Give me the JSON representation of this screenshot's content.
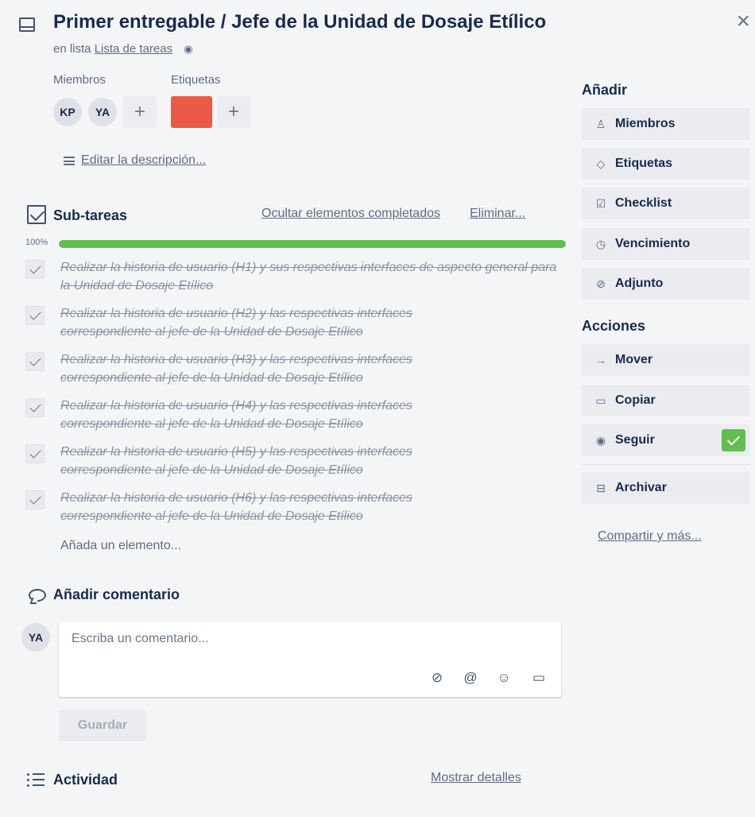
{
  "card": {
    "title": "Primer entregable / Jefe de la Unidad de Dosaje Etílico",
    "in_list_prefix": "en lista",
    "list_name": "Lista de tareas",
    "close_glyph": "×",
    "eye_glyph": "👁"
  },
  "members": {
    "label": "Miembros",
    "avatars": [
      "KP",
      "YA"
    ],
    "add_glyph": "+"
  },
  "labels": {
    "label": "Etiquetas",
    "color": "#eb5a46",
    "add_glyph": "+"
  },
  "description": {
    "link": "Editar la descripción..."
  },
  "checklist": {
    "title": "Sub-tareas",
    "hide_completed": "Ocultar elementos completados",
    "delete": "Eliminar...",
    "percent_label": "100%",
    "progress": 1.0,
    "progress_color": "#61bd4f",
    "items": [
      {
        "text": "Realizar la historia de usuario (H1) y sus respectivas interfaces de aspecto general para la Unidad de Dosaje Etílico",
        "checked": true
      },
      {
        "text": "Realizar la historia de usuario (H2) y las respectivas interfaces correspondiente al jefe de la Unidad de Dosaje Etílico",
        "checked": true
      },
      {
        "text": "Realizar la historia de usuario (H3) y las respectivas interfaces correspondiente al jefe de la Unidad de Dosaje Etílico",
        "checked": true
      },
      {
        "text": "Realizar la historia de usuario (H4) y las respectivas interfaces correspondiente al jefe de la Unidad de Dosaje Etílico",
        "checked": true
      },
      {
        "text": "Realizar la historia de usuario (H5) y las respectivas interfaces correspondiente al jefe de la Unidad de Dosaje Etílico",
        "checked": true
      },
      {
        "text": "Realizar la historia de usuario (H6) y las respectivas interfaces correspondiente al jefe de la Unidad de Dosaje Etílico",
        "checked": true
      }
    ],
    "add_item": "Añada un elemento..."
  },
  "comment": {
    "title": "Añadir comentario",
    "avatar": "YA",
    "placeholder": "Escriba un comentario...",
    "icons": {
      "attach": "⊘",
      "mention": "@",
      "emoji": "☺",
      "card": "▭"
    },
    "save": "Guardar"
  },
  "activity": {
    "title": "Actividad",
    "show_details": "Mostrar detalles"
  },
  "sidebar": {
    "add_heading": "Añadir",
    "add_buttons": [
      {
        "label": "Miembros",
        "icon": "person-icon",
        "glyph": "♙"
      },
      {
        "label": "Etiquetas",
        "icon": "tag-icon",
        "glyph": "◇"
      },
      {
        "label": "Checklist",
        "icon": "checkbox-icon",
        "glyph": "☑"
      },
      {
        "label": "Vencimiento",
        "icon": "clock-icon",
        "glyph": "◷"
      },
      {
        "label": "Adjunto",
        "icon": "paperclip-icon",
        "glyph": "⊘"
      }
    ],
    "actions_heading": "Acciones",
    "action_buttons": [
      {
        "label": "Mover",
        "icon": "arrow-right-icon",
        "glyph": "→"
      },
      {
        "label": "Copiar",
        "icon": "card-icon",
        "glyph": "▭"
      },
      {
        "label": "Seguir",
        "icon": "eye-icon",
        "glyph": "◉",
        "active": true,
        "active_color": "#61bd4f"
      }
    ],
    "archive": {
      "label": "Archivar",
      "icon": "archive-icon",
      "glyph": "🗃"
    },
    "share_link": "Compartir y más..."
  }
}
